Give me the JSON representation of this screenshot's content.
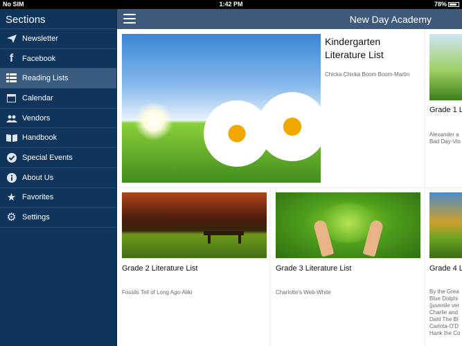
{
  "status": {
    "carrier": "No SIM",
    "time": "1:42 PM",
    "battery": "78%"
  },
  "sidebar": {
    "title": "Sections",
    "items": [
      {
        "label": "Newsletter",
        "icon": "paper-plane-icon"
      },
      {
        "label": "Facebook",
        "icon": "facebook-icon"
      },
      {
        "label": "Reading Lists",
        "icon": "list-icon",
        "active": true
      },
      {
        "label": "Calendar",
        "icon": "calendar-icon"
      },
      {
        "label": "Vendors",
        "icon": "people-icon"
      },
      {
        "label": "Handbook",
        "icon": "book-icon"
      },
      {
        "label": "Special Events",
        "icon": "check-circle-icon"
      },
      {
        "label": "About Us",
        "icon": "info-icon"
      },
      {
        "label": "Favorites",
        "icon": "star-icon"
      },
      {
        "label": "Settings",
        "icon": "gear-icon"
      }
    ]
  },
  "header": {
    "title": "New Day Academy"
  },
  "cards": [
    {
      "title": "Kindergarten Literature List",
      "desc": "Chicka Chicka Boom Boom-Martin"
    },
    {
      "title": "Grade 1 L",
      "desc": "Alexander a Bad Day-Vio"
    },
    {
      "title": "Grade 2 Literature List",
      "desc": "Fossils Tell of Long Ago-Aliki"
    },
    {
      "title": "Grade 3 Literature List",
      "desc": "Charlotte's Web-White"
    },
    {
      "title": "Grade 4 L",
      "desc": "By the Grea Blue Dolphi (juvenile ver Charlie and Dahl The Bl Carlota-O'D Hank the Co"
    }
  ]
}
